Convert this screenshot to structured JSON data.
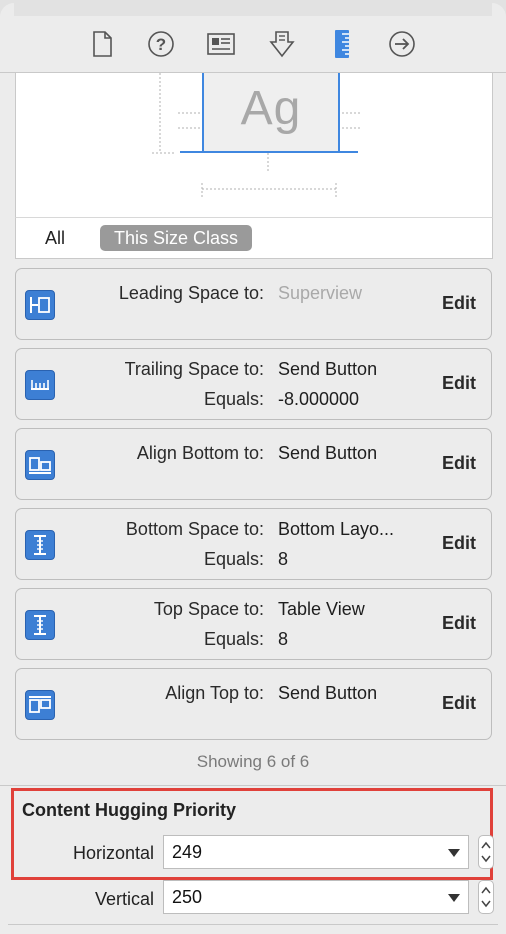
{
  "toolbar": {
    "icons": [
      "file-icon",
      "quick-help-icon",
      "identity-icon",
      "attributes-icon",
      "size-ruler-icon",
      "connections-arrow-icon"
    ],
    "active_index": 4
  },
  "preview": {
    "sample_text": "Ag"
  },
  "size_filter": {
    "all_label": "All",
    "size_class_label": "This Size Class"
  },
  "constraints": [
    {
      "label": "Leading Space to:",
      "value": "Superview",
      "value_dim": true,
      "edit": "Edit",
      "icon": "leading-space-icon"
    },
    {
      "label": "Trailing Space to:",
      "value": "Send Button",
      "label2": "Equals:",
      "value2": "-8.000000",
      "edit": "Edit",
      "icon": "trailing-space-icon"
    },
    {
      "label": "Align Bottom to:",
      "value": "Send Button",
      "edit": "Edit",
      "icon": "align-bottom-icon"
    },
    {
      "label": "Bottom Space to:",
      "value": "Bottom Layo...",
      "label2": "Equals:",
      "value2": "8",
      "edit": "Edit",
      "icon": "bottom-space-icon"
    },
    {
      "label": "Top Space to:",
      "value": "Table View",
      "label2": "Equals:",
      "value2": "8",
      "edit": "Edit",
      "icon": "top-space-icon"
    },
    {
      "label": "Align Top to:",
      "value": "Send Button",
      "edit": "Edit",
      "icon": "align-top-icon"
    }
  ],
  "showing": "Showing 6 of 6",
  "hugging": {
    "title": "Content Hugging Priority",
    "horizontal_label": "Horizontal",
    "horizontal_value": "249",
    "vertical_label": "Vertical",
    "vertical_value": "250"
  },
  "colors": {
    "accent": "#3f87e0",
    "highlight": "#e0413a",
    "constraint_icon": "#3d7fd4"
  }
}
